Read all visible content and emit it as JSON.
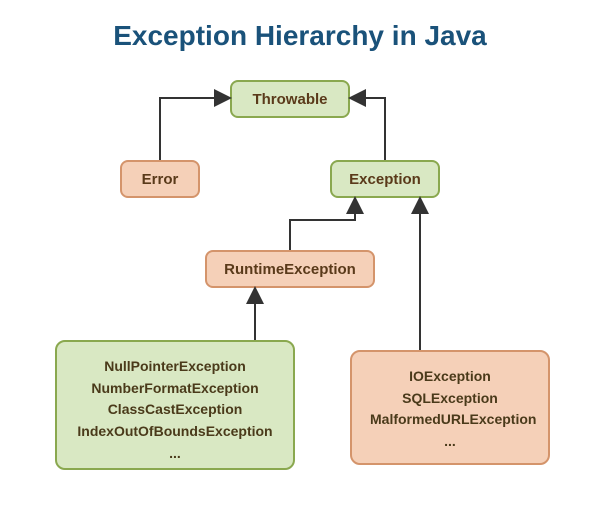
{
  "title": "Exception Hierarchy in Java",
  "nodes": {
    "throwable": "Throwable",
    "error": "Error",
    "exception": "Exception",
    "runtime": "RuntimeException"
  },
  "runtime_children": [
    "NullPointerException",
    "NumberFormatException",
    "ClassCastException",
    "IndexOutOfBoundsException",
    "..."
  ],
  "exception_children": [
    "IOException",
    "SQLException",
    "MalformedURLException",
    "..."
  ]
}
